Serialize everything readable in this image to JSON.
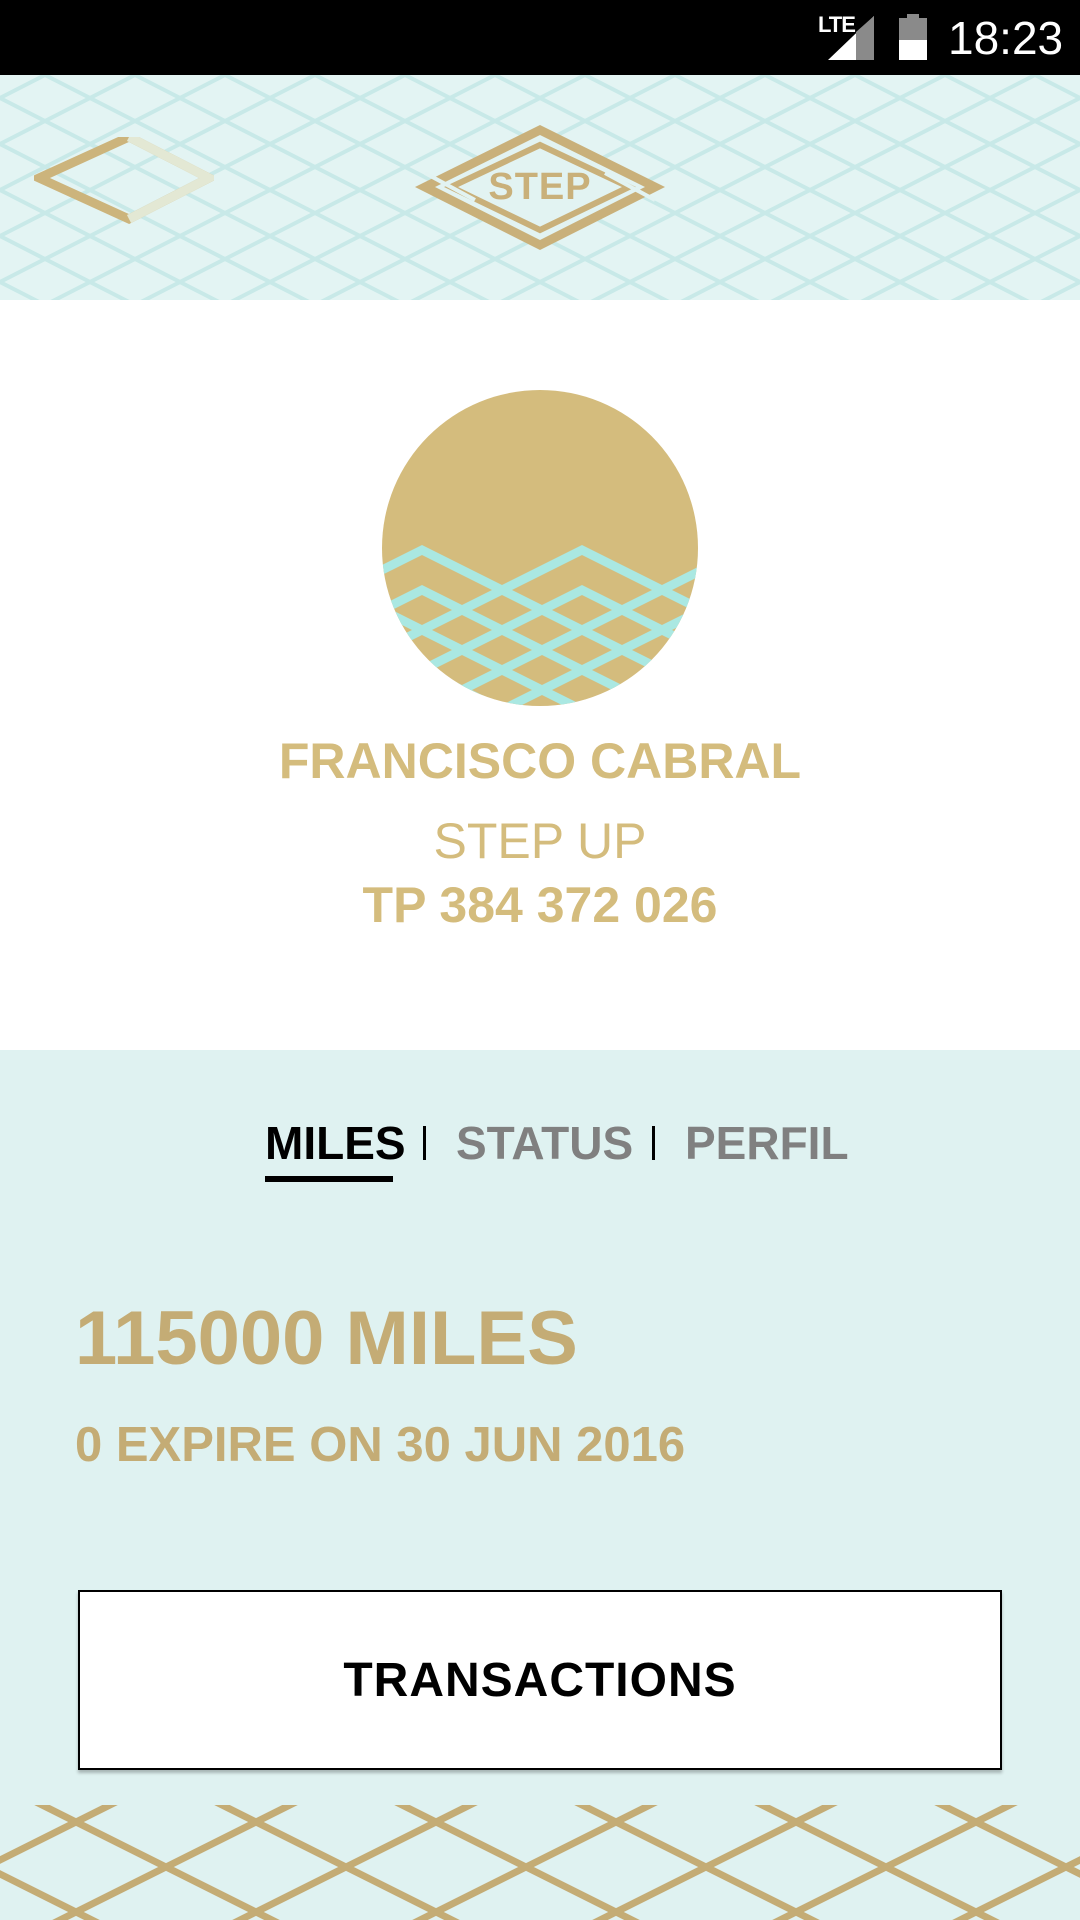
{
  "status_bar": {
    "network": "LTE",
    "time": "18:23",
    "icons": [
      "signal-icon",
      "battery-icon"
    ]
  },
  "header": {
    "back_icon": "diamond-back-icon",
    "logo_text": "STEP"
  },
  "profile": {
    "name": "FRANCISCO CABRAL",
    "tier": "STEP UP",
    "member_id": "TP 384 372 026"
  },
  "tabs": [
    {
      "label": "MILES",
      "active": true
    },
    {
      "label": "STATUS",
      "active": false
    },
    {
      "label": "PERFIL",
      "active": false
    }
  ],
  "miles": {
    "total": "115000 MILES",
    "expire": "0 EXPIRE ON 30 JUN 2016"
  },
  "transactions_button": {
    "label": "TRANSACTIONS"
  },
  "colors": {
    "gold": "#d4bc7d",
    "mint": "#dff2f1",
    "aqua": "#a9e9e3",
    "black": "#000000",
    "gray": "#808080"
  }
}
